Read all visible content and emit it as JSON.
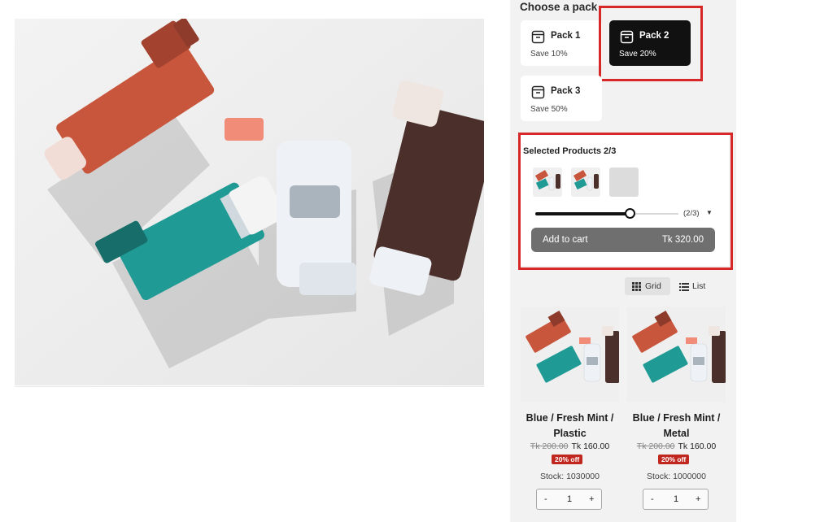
{
  "hero": {
    "alt": "Assorted inhalers"
  },
  "pack_selector": {
    "title": "Choose a pack",
    "packs": [
      {
        "name": "Pack 1",
        "save": "Save 10%",
        "selected": false
      },
      {
        "name": "Pack 2",
        "save": "Save 20%",
        "selected": true
      },
      {
        "name": "Pack 3",
        "save": "Save 50%",
        "selected": false
      }
    ]
  },
  "selection": {
    "title": "Selected Products 2/3",
    "progress_label": "(2/3)",
    "progress_fraction": 0.667,
    "add_to_cart_label": "Add to cart",
    "total": "Tk 320.00"
  },
  "view_toggle": {
    "grid_label": "Grid",
    "list_label": "List",
    "active": "grid"
  },
  "products": [
    {
      "title_line1": "Blue / Fresh Mint /",
      "title_line2": "Plastic",
      "old_price": "Tk 200.00",
      "new_price": "Tk 160.00",
      "badge": "20% off",
      "stock": "Stock: 1030000",
      "qty": "1"
    },
    {
      "title_line1": "Blue / Fresh Mint /",
      "title_line2": "Metal",
      "old_price": "Tk 200.00",
      "new_price": "Tk 160.00",
      "badge": "20% off",
      "stock": "Stock: 1000000",
      "qty": "1"
    }
  ],
  "stepper": {
    "minus": "-",
    "plus": "+"
  },
  "colors": {
    "highlight": "#d62828",
    "selected_pack": "#111111",
    "button": "#6f6f6f",
    "badge": "#c0271f",
    "inhaler_orange": "#c8563c",
    "inhaler_teal": "#1f9a94",
    "inhaler_brown": "#4a2f2a",
    "inhaler_white": "#eef2f6"
  }
}
